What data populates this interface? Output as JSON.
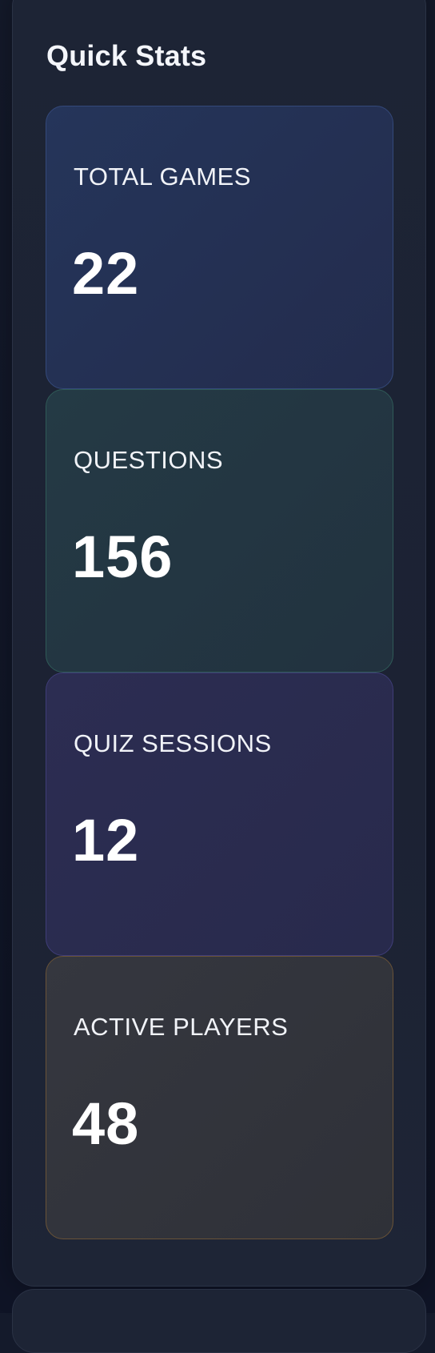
{
  "quick_stats": {
    "title": "Quick Stats",
    "cards": [
      {
        "label": "TOTAL GAMES",
        "value": "22",
        "accent": "#34497a"
      },
      {
        "label": "QUESTIONS",
        "value": "156",
        "accent": "#2f5a57"
      },
      {
        "label": "QUIZ SESSIONS",
        "value": "12",
        "accent": "#3f3d78"
      },
      {
        "label": "ACTIVE PLAYERS",
        "value": "48",
        "accent": "#6a5337"
      }
    ]
  }
}
